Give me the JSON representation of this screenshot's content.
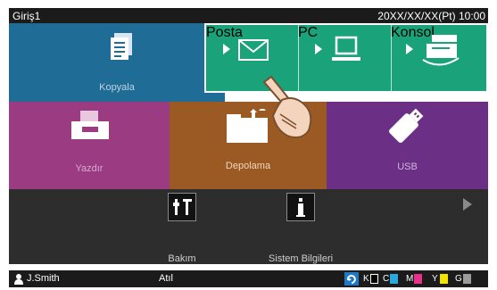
{
  "topbar": {
    "mode": "Giriş1",
    "datetime": "20XX/XX/XX(Pt) 10:00"
  },
  "tiles": {
    "copy": {
      "label": "Kopyala"
    },
    "print": {
      "label": "Yazdır"
    },
    "storage": {
      "label": "Depolama"
    },
    "usb": {
      "label": "USB"
    }
  },
  "popup": {
    "items": [
      {
        "label": "Posta",
        "icon": "envelope-icon"
      },
      {
        "label": "PC",
        "icon": "laptop-icon"
      },
      {
        "label": "Konsol",
        "icon": "scanner-icon"
      }
    ]
  },
  "tools": {
    "maintenance": {
      "label": "Bakım"
    },
    "system_info": {
      "label": "Sistem Bilgileri"
    }
  },
  "bottombar": {
    "user": "J.Smith",
    "status": "Atıl",
    "inks": [
      {
        "label": "K",
        "color": "#000000"
      },
      {
        "label": "C",
        "color": "#29a9e1"
      },
      {
        "label": "M",
        "color": "#e8308a"
      },
      {
        "label": "Y",
        "color": "#f1e500"
      },
      {
        "label": "G",
        "color": "#9b9b9b"
      }
    ]
  },
  "colors": {
    "copy": "#1f6d96",
    "print": "#9b3c83",
    "storage": "#9b5a23",
    "usb": "#6b2f86",
    "scan_popup": "#1aa37a"
  }
}
